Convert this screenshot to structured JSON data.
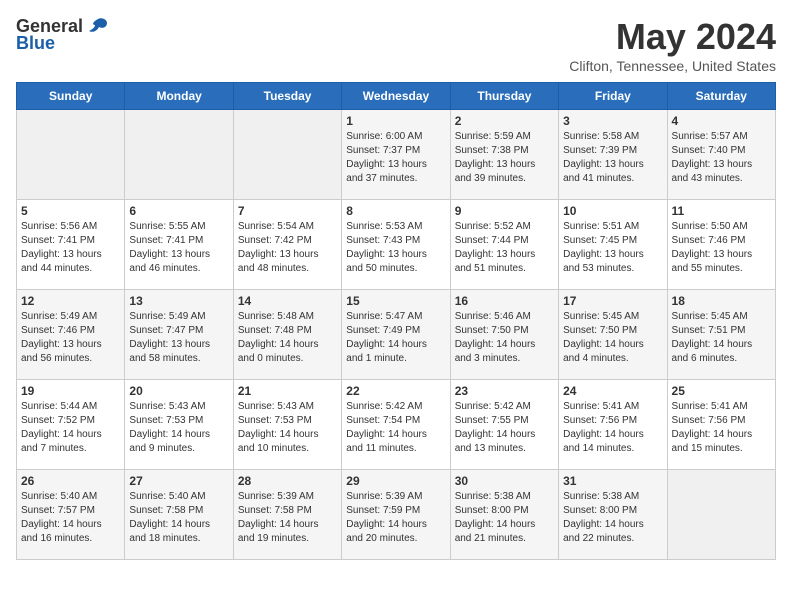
{
  "header": {
    "logo_general": "General",
    "logo_blue": "Blue",
    "month_title": "May 2024",
    "location": "Clifton, Tennessee, United States"
  },
  "days_of_week": [
    "Sunday",
    "Monday",
    "Tuesday",
    "Wednesday",
    "Thursday",
    "Friday",
    "Saturday"
  ],
  "weeks": [
    [
      {
        "day": "",
        "info": ""
      },
      {
        "day": "",
        "info": ""
      },
      {
        "day": "",
        "info": ""
      },
      {
        "day": "1",
        "info": "Sunrise: 6:00 AM\nSunset: 7:37 PM\nDaylight: 13 hours\nand 37 minutes."
      },
      {
        "day": "2",
        "info": "Sunrise: 5:59 AM\nSunset: 7:38 PM\nDaylight: 13 hours\nand 39 minutes."
      },
      {
        "day": "3",
        "info": "Sunrise: 5:58 AM\nSunset: 7:39 PM\nDaylight: 13 hours\nand 41 minutes."
      },
      {
        "day": "4",
        "info": "Sunrise: 5:57 AM\nSunset: 7:40 PM\nDaylight: 13 hours\nand 43 minutes."
      }
    ],
    [
      {
        "day": "5",
        "info": "Sunrise: 5:56 AM\nSunset: 7:41 PM\nDaylight: 13 hours\nand 44 minutes."
      },
      {
        "day": "6",
        "info": "Sunrise: 5:55 AM\nSunset: 7:41 PM\nDaylight: 13 hours\nand 46 minutes."
      },
      {
        "day": "7",
        "info": "Sunrise: 5:54 AM\nSunset: 7:42 PM\nDaylight: 13 hours\nand 48 minutes."
      },
      {
        "day": "8",
        "info": "Sunrise: 5:53 AM\nSunset: 7:43 PM\nDaylight: 13 hours\nand 50 minutes."
      },
      {
        "day": "9",
        "info": "Sunrise: 5:52 AM\nSunset: 7:44 PM\nDaylight: 13 hours\nand 51 minutes."
      },
      {
        "day": "10",
        "info": "Sunrise: 5:51 AM\nSunset: 7:45 PM\nDaylight: 13 hours\nand 53 minutes."
      },
      {
        "day": "11",
        "info": "Sunrise: 5:50 AM\nSunset: 7:46 PM\nDaylight: 13 hours\nand 55 minutes."
      }
    ],
    [
      {
        "day": "12",
        "info": "Sunrise: 5:49 AM\nSunset: 7:46 PM\nDaylight: 13 hours\nand 56 minutes."
      },
      {
        "day": "13",
        "info": "Sunrise: 5:49 AM\nSunset: 7:47 PM\nDaylight: 13 hours\nand 58 minutes."
      },
      {
        "day": "14",
        "info": "Sunrise: 5:48 AM\nSunset: 7:48 PM\nDaylight: 14 hours\nand 0 minutes."
      },
      {
        "day": "15",
        "info": "Sunrise: 5:47 AM\nSunset: 7:49 PM\nDaylight: 14 hours\nand 1 minute."
      },
      {
        "day": "16",
        "info": "Sunrise: 5:46 AM\nSunset: 7:50 PM\nDaylight: 14 hours\nand 3 minutes."
      },
      {
        "day": "17",
        "info": "Sunrise: 5:45 AM\nSunset: 7:50 PM\nDaylight: 14 hours\nand 4 minutes."
      },
      {
        "day": "18",
        "info": "Sunrise: 5:45 AM\nSunset: 7:51 PM\nDaylight: 14 hours\nand 6 minutes."
      }
    ],
    [
      {
        "day": "19",
        "info": "Sunrise: 5:44 AM\nSunset: 7:52 PM\nDaylight: 14 hours\nand 7 minutes."
      },
      {
        "day": "20",
        "info": "Sunrise: 5:43 AM\nSunset: 7:53 PM\nDaylight: 14 hours\nand 9 minutes."
      },
      {
        "day": "21",
        "info": "Sunrise: 5:43 AM\nSunset: 7:53 PM\nDaylight: 14 hours\nand 10 minutes."
      },
      {
        "day": "22",
        "info": "Sunrise: 5:42 AM\nSunset: 7:54 PM\nDaylight: 14 hours\nand 11 minutes."
      },
      {
        "day": "23",
        "info": "Sunrise: 5:42 AM\nSunset: 7:55 PM\nDaylight: 14 hours\nand 13 minutes."
      },
      {
        "day": "24",
        "info": "Sunrise: 5:41 AM\nSunset: 7:56 PM\nDaylight: 14 hours\nand 14 minutes."
      },
      {
        "day": "25",
        "info": "Sunrise: 5:41 AM\nSunset: 7:56 PM\nDaylight: 14 hours\nand 15 minutes."
      }
    ],
    [
      {
        "day": "26",
        "info": "Sunrise: 5:40 AM\nSunset: 7:57 PM\nDaylight: 14 hours\nand 16 minutes."
      },
      {
        "day": "27",
        "info": "Sunrise: 5:40 AM\nSunset: 7:58 PM\nDaylight: 14 hours\nand 18 minutes."
      },
      {
        "day": "28",
        "info": "Sunrise: 5:39 AM\nSunset: 7:58 PM\nDaylight: 14 hours\nand 19 minutes."
      },
      {
        "day": "29",
        "info": "Sunrise: 5:39 AM\nSunset: 7:59 PM\nDaylight: 14 hours\nand 20 minutes."
      },
      {
        "day": "30",
        "info": "Sunrise: 5:38 AM\nSunset: 8:00 PM\nDaylight: 14 hours\nand 21 minutes."
      },
      {
        "day": "31",
        "info": "Sunrise: 5:38 AM\nSunset: 8:00 PM\nDaylight: 14 hours\nand 22 minutes."
      },
      {
        "day": "",
        "info": ""
      }
    ]
  ]
}
